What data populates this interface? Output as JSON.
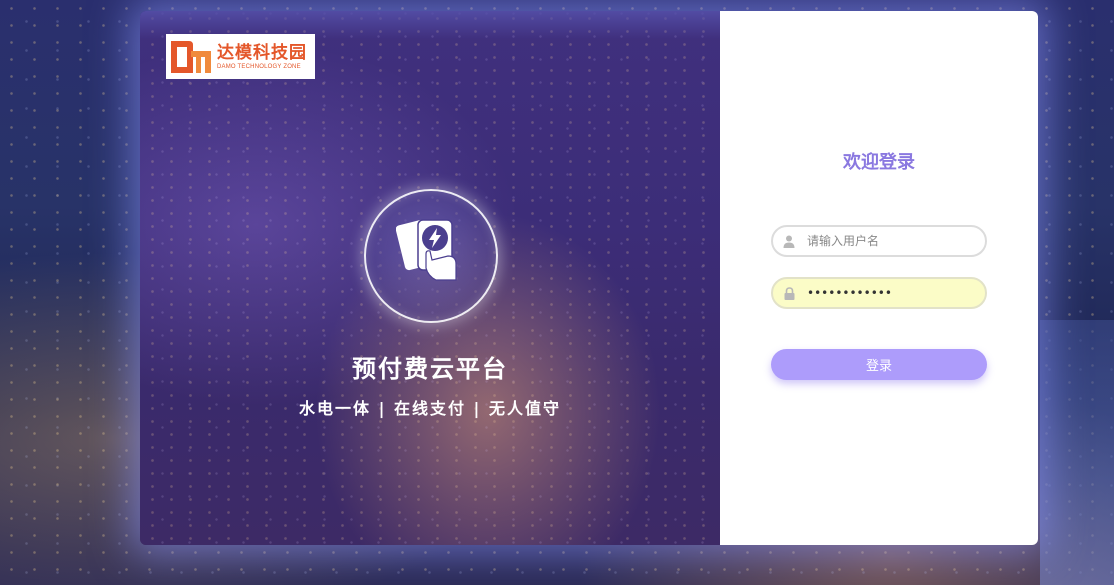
{
  "brand": {
    "logo_title": "达模科技园",
    "logo_subtitle": "DAMO TECHNOLOGY ZONE",
    "color": "#e4572a"
  },
  "hero": {
    "title": "预付费云平台",
    "slogan": "水电一体 | 在线支付 | 无人值守",
    "emblem_icon": "prepaid-card-icon"
  },
  "login": {
    "heading": "欢迎登录",
    "heading_color": "#8a78e0",
    "username": {
      "placeholder": "请输入用户名",
      "value": "",
      "icon": "user-icon"
    },
    "password": {
      "placeholder": "",
      "value": "ZZZZZZZZZZZZ",
      "icon": "lock-icon"
    },
    "submit_label": "登录",
    "button_color": "#ad9cfb"
  }
}
